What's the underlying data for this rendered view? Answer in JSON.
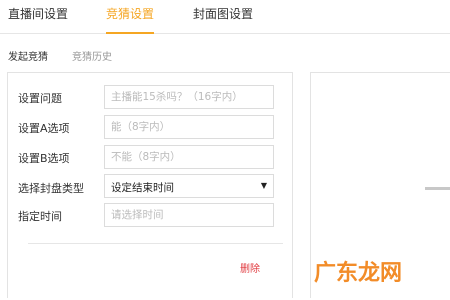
{
  "top_tabs": [
    {
      "label": "直播间设置",
      "active": false
    },
    {
      "label": "竞猜设置",
      "active": true
    },
    {
      "label": "封面图设置",
      "active": false
    }
  ],
  "sub_tabs": [
    {
      "label": "发起竞猜",
      "active": true
    },
    {
      "label": "竞猜历史",
      "active": false
    }
  ],
  "form": {
    "question": {
      "label": "设置问题",
      "placeholder": "主播能15杀吗？（16字内）",
      "value": ""
    },
    "option_a": {
      "label": "设置A选项",
      "placeholder": "能（8字内）",
      "value": ""
    },
    "option_b": {
      "label": "设置B选项",
      "placeholder": "不能（8字内）",
      "value": ""
    },
    "close_type": {
      "label": "选择封盘类型",
      "selected": "设定结束时间"
    },
    "close_time": {
      "label": "指定时间",
      "placeholder": "请选择时间",
      "value": ""
    },
    "delete_label": "删除"
  },
  "watermark": {
    "text": "广东龙网",
    "color": "#f28c28"
  },
  "colors": {
    "accent": "#f5a623",
    "danger": "#e0393e",
    "border": "#dcdcdc"
  }
}
